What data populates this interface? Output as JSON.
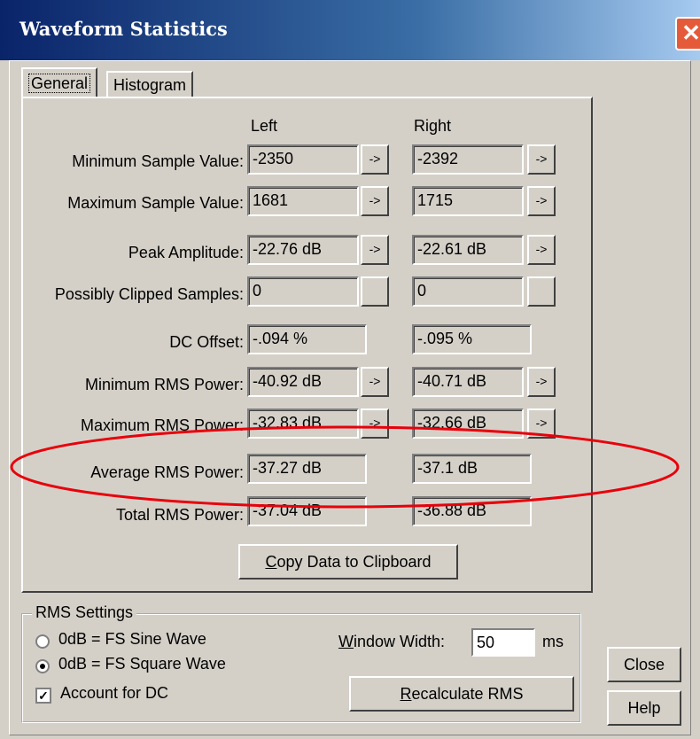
{
  "window": {
    "title": "Waveform Statistics",
    "close_glyph": "✕"
  },
  "tabs": [
    {
      "label": "General"
    },
    {
      "label": "Histogram"
    }
  ],
  "columns": {
    "left": "Left",
    "right": "Right"
  },
  "arrow_glyph": "->",
  "rows": [
    {
      "label": "Minimum Sample Value:",
      "left": "-2350",
      "right": "-2392"
    },
    {
      "label": "Maximum Sample Value:",
      "left": "1681",
      "right": "1715"
    },
    {
      "label": "Peak Amplitude:",
      "left": "-22.76 dB",
      "right": "-22.61 dB"
    },
    {
      "label": "Possibly Clipped Samples:",
      "left": "0",
      "right": "0"
    },
    {
      "label": "DC Offset:",
      "left": "-.094 %",
      "right": "-.095 %"
    },
    {
      "label": "Minimum RMS Power:",
      "left": "-40.92 dB",
      "right": "-40.71 dB"
    },
    {
      "label": "Maximum RMS Power:",
      "left": "-32.83 dB",
      "right": "-32.66 dB"
    },
    {
      "label": "Average RMS Power:",
      "left": "-37.27 dB",
      "right": "-37.1 dB"
    },
    {
      "label": "Total RMS Power:",
      "left": "-37.04 dB",
      "right": "-36.88 dB"
    }
  ],
  "copy_button": "Copy Data to Clipboard",
  "rms": {
    "group_title": "RMS Settings",
    "option_sine": "0dB = FS Sine Wave",
    "option_square": "0dB = FS Square Wave",
    "selected": "square",
    "account_dc": "Account for DC",
    "account_dc_checked": true,
    "window_width_label": "Window Width:",
    "window_width_value": "50",
    "window_width_unit": "ms",
    "recalc_button": "Recalculate RMS"
  },
  "buttons": {
    "close": "Close",
    "help": "Help"
  },
  "annotation": {
    "color": "#e8000b"
  }
}
